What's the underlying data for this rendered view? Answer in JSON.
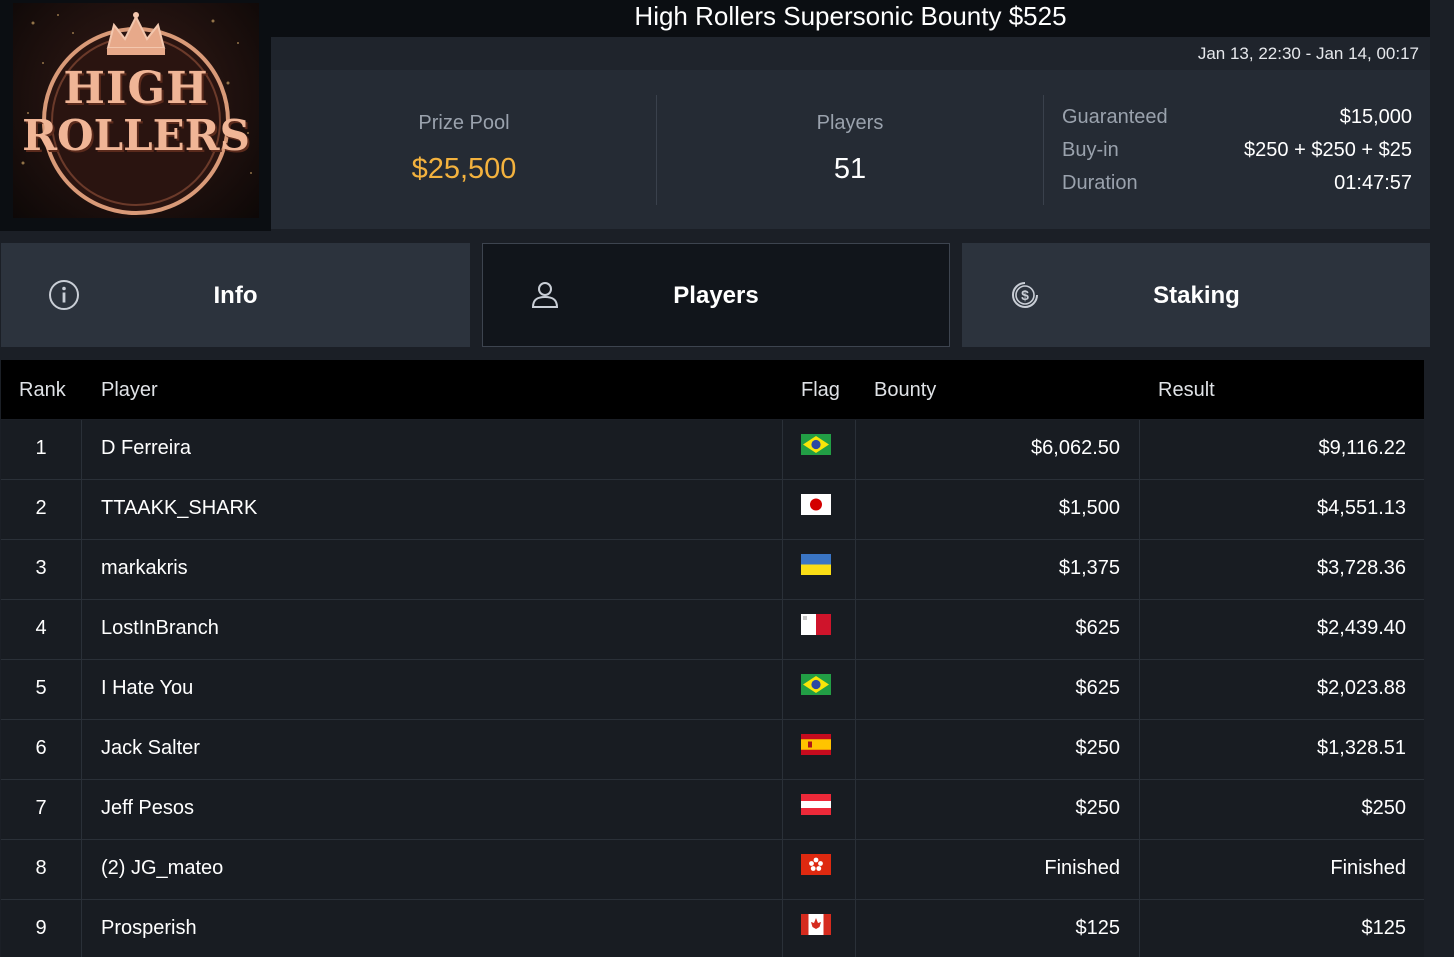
{
  "logo": {
    "line1": "HIGH",
    "line2": "ROLLERS",
    "icon": "crown-icon"
  },
  "header": {
    "title": "High Rollers Supersonic Bounty $525",
    "dates": "Jan 13, 22:30 - Jan 14, 00:17"
  },
  "stats": {
    "prize_pool_label": "Prize Pool",
    "prize_pool_value": "$25,500",
    "players_label": "Players",
    "players_value": "51",
    "guaranteed_label": "Guaranteed",
    "guaranteed_value": "$15,000",
    "buyin_label": "Buy-in",
    "buyin_value": "$250 + $250 + $25",
    "duration_label": "Duration",
    "duration_value": "01:47:57"
  },
  "tabs": [
    {
      "label": "Info",
      "icon": "info-icon",
      "active": false
    },
    {
      "label": "Players",
      "icon": "user-icon",
      "active": true
    },
    {
      "label": "Staking",
      "icon": "dollar-coin-icon",
      "active": false
    }
  ],
  "table": {
    "columns": {
      "rank": "Rank",
      "player": "Player",
      "flag": "Flag",
      "bounty": "Bounty",
      "result": "Result"
    },
    "rows": [
      {
        "rank": "1",
        "player": "D Ferreira",
        "flag": "brazil",
        "bounty": "$6,062.50",
        "result": "$9,116.22"
      },
      {
        "rank": "2",
        "player": "TTAAKK_SHARK",
        "flag": "japan",
        "bounty": "$1,500",
        "result": "$4,551.13"
      },
      {
        "rank": "3",
        "player": "markakris",
        "flag": "ukraine",
        "bounty": "$1,375",
        "result": "$3,728.36"
      },
      {
        "rank": "4",
        "player": "LostInBranch",
        "flag": "malta",
        "bounty": "$625",
        "result": "$2,439.40"
      },
      {
        "rank": "5",
        "player": "I Hate You",
        "flag": "brazil",
        "bounty": "$625",
        "result": "$2,023.88"
      },
      {
        "rank": "6",
        "player": "Jack Salter",
        "flag": "spain",
        "bounty": "$250",
        "result": "$1,328.51"
      },
      {
        "rank": "7",
        "player": "Jeff Pesos",
        "flag": "austria",
        "bounty": "$250",
        "result": "$250"
      },
      {
        "rank": "8",
        "player": "(2) JG_mateo",
        "flag": "hongkong",
        "bounty": "Finished",
        "result": "Finished"
      },
      {
        "rank": "9",
        "player": "Prosperish",
        "flag": "canada",
        "bounty": "$125",
        "result": "$125"
      }
    ]
  },
  "colors": {
    "gold": "#f3b23e",
    "bg": "#1b1f26",
    "panel": "#252b34",
    "tab": "#2c333d"
  }
}
